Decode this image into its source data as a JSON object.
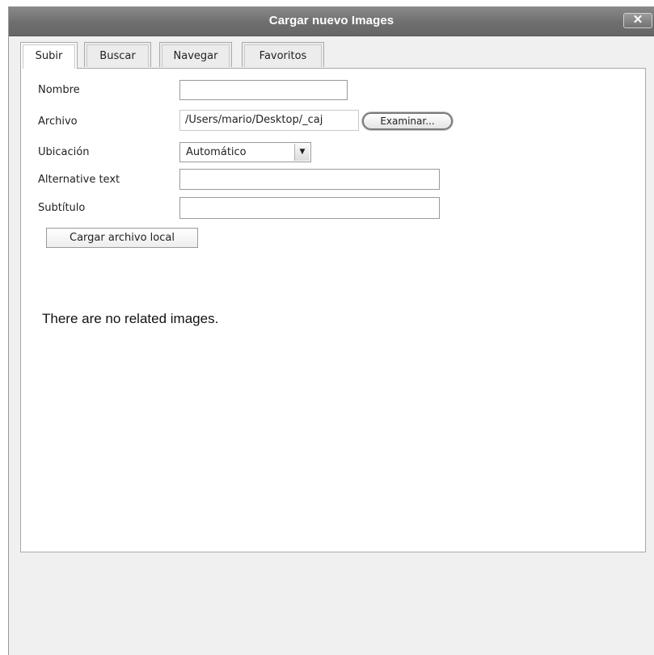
{
  "window": {
    "title": "Cargar nuevo Images",
    "close_label": "x"
  },
  "tabs": [
    {
      "label": "Subir",
      "active": true
    },
    {
      "label": "Buscar",
      "active": false
    },
    {
      "label": "Navegar",
      "active": false
    },
    {
      "label": "Favoritos",
      "active": false
    }
  ],
  "form": {
    "nombre_label": "Nombre",
    "nombre_value": "",
    "archivo_label": "Archivo",
    "archivo_value": "/Users/mario/Desktop/_caj",
    "browse_label": "Examinar...",
    "ubicacion_label": "Ubicación",
    "ubicacion_value": "Automático",
    "alt_label": "Alternative text",
    "alt_value": "",
    "subtitulo_label": "Subtítulo",
    "subtitulo_value": "",
    "upload_label": "Cargar archivo local"
  },
  "related": {
    "empty_message": "There are no related images."
  }
}
